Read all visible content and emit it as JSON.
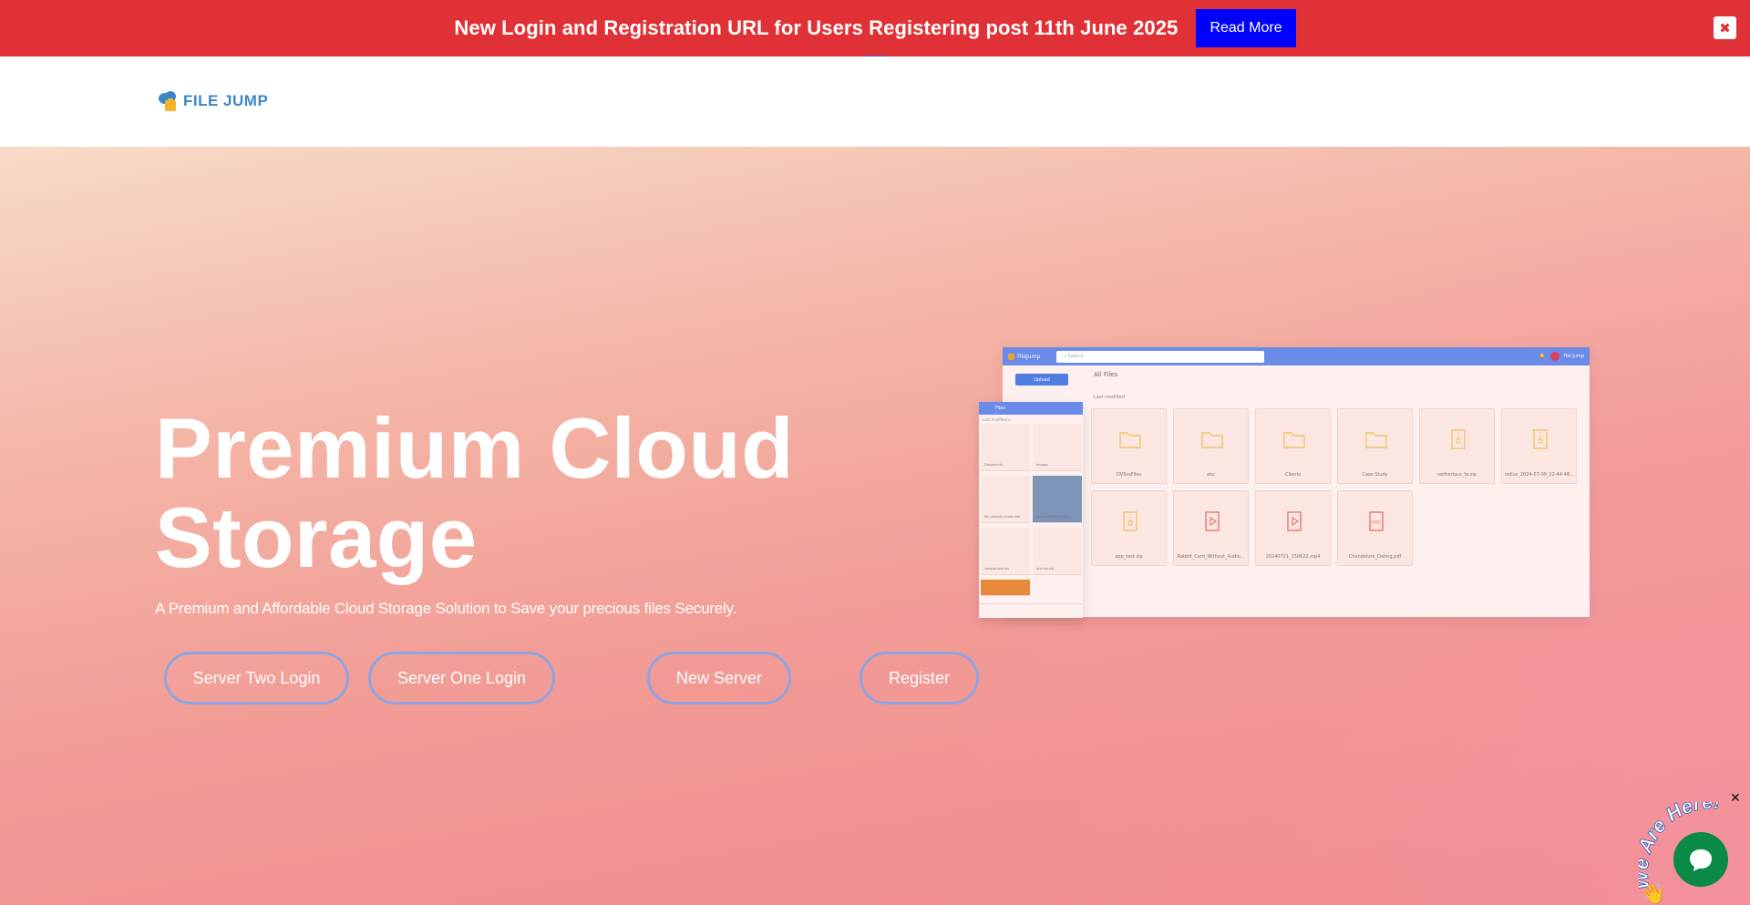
{
  "announcement": {
    "text": "New Login and Registration URL for Users Registering post 11th June 2025",
    "read_more_label": "Read More",
    "close_glyph": "✖"
  },
  "header": {
    "logo_text": "FILE JUMP"
  },
  "hero": {
    "title": "Premium Cloud Storage",
    "subtitle": "A Premium and Affordable Cloud Storage Solution to Save your precious files Securely.",
    "buttons": {
      "server_two": "Server Two Login",
      "server_one": "Server One Login",
      "new_server": "New Server",
      "register": "Register"
    }
  },
  "mockup": {
    "brand": "FileJump",
    "search_placeholder": "Search",
    "user": "File Jump",
    "upload_label": "Upload",
    "breadcrumb": "All Files",
    "sort_label": "Last modified",
    "files": [
      {
        "name": "DVSvsFiles",
        "type": "folder"
      },
      {
        "name": "abc",
        "type": "folder"
      },
      {
        "name": "Clients",
        "type": "folder"
      },
      {
        "name": "Case Study",
        "type": "folder"
      },
      {
        "name": "netherlaus_fa.zip",
        "type": "zip"
      },
      {
        "name": "cellus_2024-07-09_22-44-48...",
        "type": "zip"
      },
      {
        "name": "app_test.zip",
        "type": "zip"
      },
      {
        "name": "Rabbit_Card_Without_Audio...",
        "type": "video"
      },
      {
        "name": "20240721_150622.mp4",
        "type": "video"
      },
      {
        "name": "Chandelure_Dating.pdf",
        "type": "pdf"
      }
    ],
    "phone": {
      "title": "Files",
      "subtitle": "Last modified ▾",
      "files": [
        {
          "name": "Documents"
        },
        {
          "name": "Images"
        },
        {
          "name": "file_sample_sheet.xlsx"
        },
        {
          "name": "plane-3486065_640.j..."
        },
        {
          "name": "sample-text.txt"
        },
        {
          "name": "archive.zip"
        }
      ]
    }
  },
  "chat": {
    "badge_text": "We Are Here!",
    "close_glyph": "✕"
  },
  "colors": {
    "announcement_bg": "#e03236",
    "read_more_bg": "#0000ff",
    "logo": "#3b86c6",
    "button_border": "#8ea4e0",
    "chat_green": "#0a8a44"
  }
}
